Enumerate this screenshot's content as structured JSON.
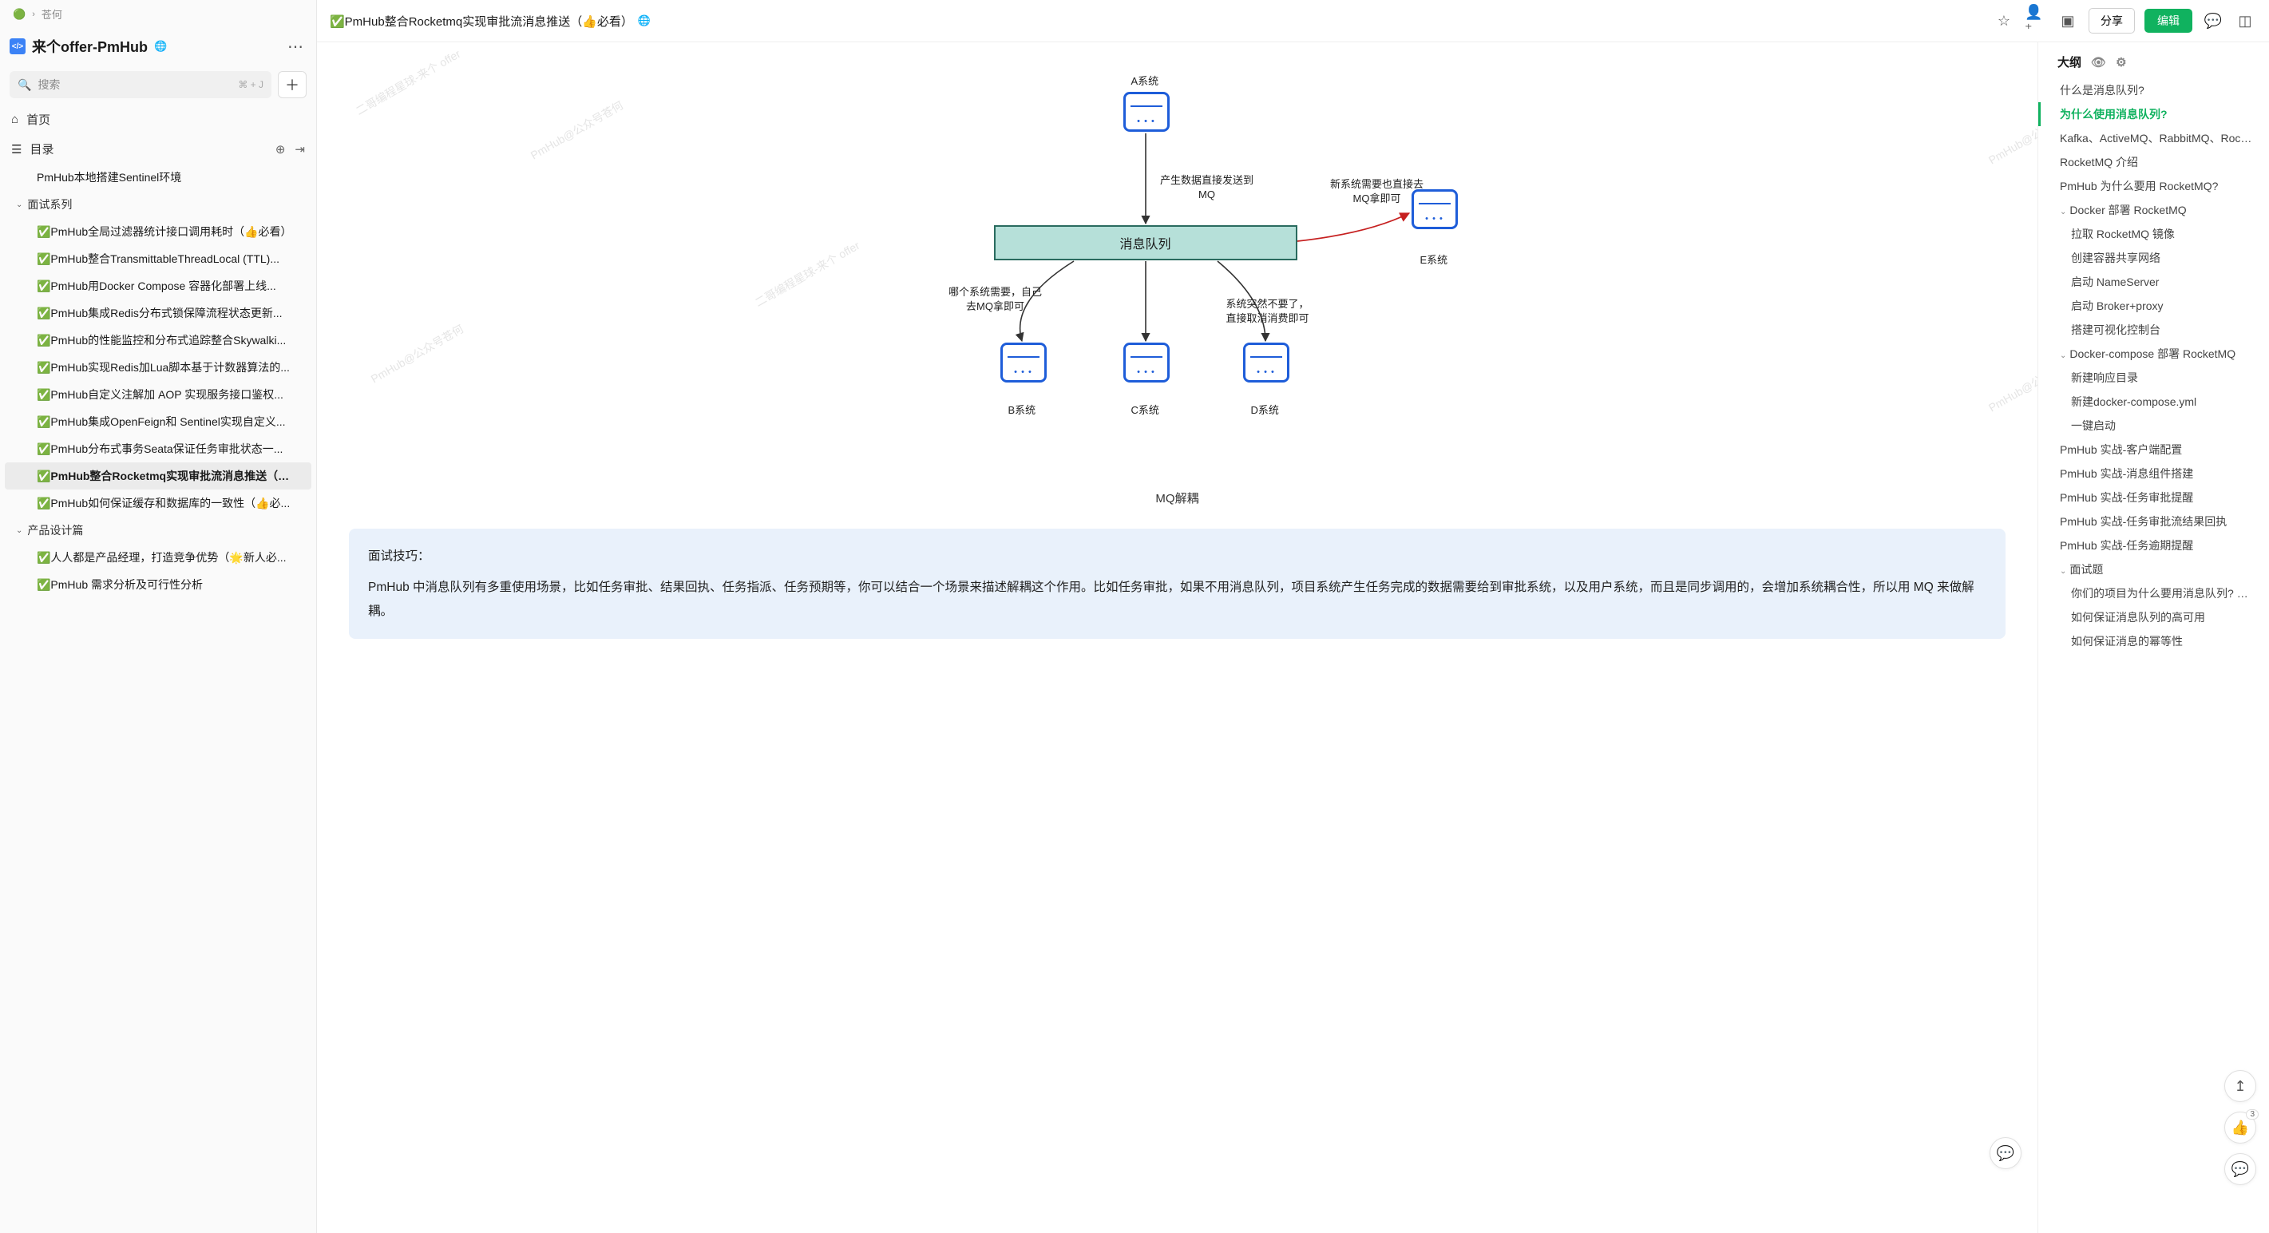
{
  "breadcrumb": {
    "parent": "苍何"
  },
  "workspace": {
    "title": "来个offer-PmHub"
  },
  "search": {
    "placeholder": "搜索",
    "shortcut": "⌘ + J"
  },
  "nav": {
    "home": "首页",
    "toc": "目录"
  },
  "tree": {
    "item_sentinel": "PmHub本地搭建Sentinel环境",
    "section_interview": "面试系列",
    "items": [
      "✅PmHub全局过滤器统计接口调用耗时（👍必看）",
      "✅PmHub整合TransmittableThreadLocal (TTL)...",
      "✅PmHub用Docker Compose 容器化部署上线...",
      "✅PmHub集成Redis分布式锁保障流程状态更新...",
      "✅PmHub的性能监控和分布式追踪整合Skywalki...",
      "✅PmHub实现Redis加Lua脚本基于计数器算法的...",
      "✅PmHub自定义注解加 AOP 实现服务接口鉴权...",
      "✅PmHub集成OpenFeign和 Sentinel实现自定义...",
      "✅PmHub分布式事务Seata保证任务审批状态一...",
      "✅PmHub整合Rocketmq实现审批流消息推送（👍...",
      "✅PmHub如何保证缓存和数据库的一致性（👍必..."
    ],
    "active_index": 9,
    "section_product": "产品设计篇",
    "product_items": [
      "✅人人都是产品经理，打造竞争优势（🌟新人必...",
      "✅PmHub 需求分析及可行性分析"
    ]
  },
  "doc": {
    "title": "✅PmHub整合Rocketmq实现审批流消息推送（👍必看）",
    "share_label": "分享",
    "edit_label": "编辑"
  },
  "diagram": {
    "node_a": "A系统",
    "node_b": "B系统",
    "node_c": "C系统",
    "node_d": "D系统",
    "node_e": "E系统",
    "queue_label": "消息队列",
    "note_top": "产生数据直接发送到MQ",
    "note_e": "新系统需要也直接去MQ拿即可",
    "note_left": "哪个系统需要，自己去MQ拿即可",
    "note_right": "系统突然不要了，直接取消消费即可",
    "caption": "MQ解耦"
  },
  "tip": {
    "title": "面试技巧：",
    "body": "PmHub 中消息队列有多重使用场景，比如任务审批、结果回执、任务指派、任务预期等，你可以结合一个场景来描述解耦这个作用。比如任务审批，如果不用消息队列，项目系统产生任务完成的数据需要给到审批系统，以及用户系统，而且是同步调用的，会增加系统耦合性，所以用 MQ 来做解耦。"
  },
  "outline": {
    "title": "大纲",
    "items": [
      {
        "t": "什么是消息队列?",
        "l": 1
      },
      {
        "t": "为什么使用消息队列?",
        "l": 1,
        "active": true
      },
      {
        "t": "Kafka、ActiveMQ、RabbitMQ、Rock...",
        "l": 1
      },
      {
        "t": "RocketMQ 介绍",
        "l": 1
      },
      {
        "t": "PmHub 为什么要用 RocketMQ?",
        "l": 1
      },
      {
        "t": "Docker 部署 RocketMQ",
        "l": 1,
        "exp": true
      },
      {
        "t": "拉取 RocketMQ 镜像",
        "l": 2
      },
      {
        "t": "创建容器共享网络",
        "l": 2
      },
      {
        "t": "启动 NameServer",
        "l": 2
      },
      {
        "t": "启动 Broker+proxy",
        "l": 2
      },
      {
        "t": "搭建可视化控制台",
        "l": 2
      },
      {
        "t": "Docker-compose 部署 RocketMQ",
        "l": 1,
        "exp": true
      },
      {
        "t": "新建响应目录",
        "l": 2
      },
      {
        "t": "新建docker-compose.yml",
        "l": 2
      },
      {
        "t": "一键启动",
        "l": 2
      },
      {
        "t": "PmHub 实战-客户端配置",
        "l": 1
      },
      {
        "t": "PmHub 实战-消息组件搭建",
        "l": 1
      },
      {
        "t": "PmHub 实战-任务审批提醒",
        "l": 1
      },
      {
        "t": "PmHub 实战-任务审批流结果回执",
        "l": 1
      },
      {
        "t": "PmHub 实战-任务逾期提醒",
        "l": 1
      },
      {
        "t": "面试题",
        "l": 1,
        "exp": true
      },
      {
        "t": "你们的项目为什么要用消息队列? 为...",
        "l": 2
      },
      {
        "t": "如何保证消息队列的高可用",
        "l": 2
      },
      {
        "t": "如何保证消息的幂等性",
        "l": 2
      }
    ]
  },
  "float": {
    "thumb_count": "3"
  },
  "watermarks": [
    "二哥编程星球-来个 offer",
    "PmHub@公众号苍何",
    "二哥编程星球-来个 offer",
    "PmHub@公众号苍何",
    "PmHub@公",
    "PmHub@公"
  ]
}
